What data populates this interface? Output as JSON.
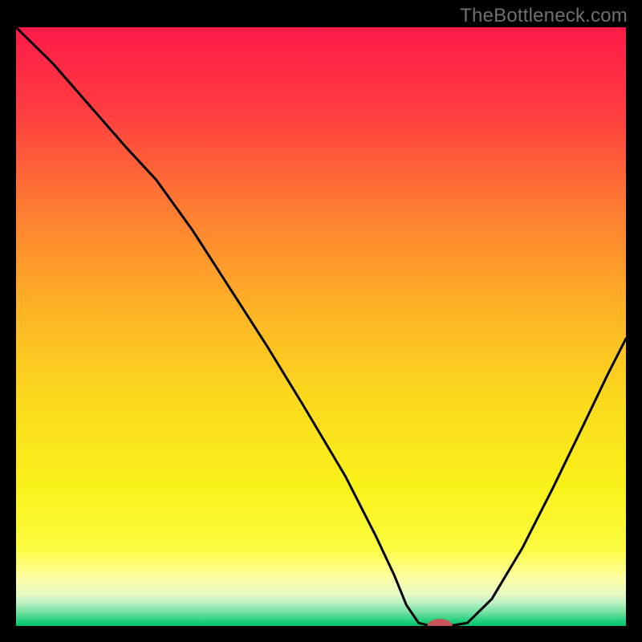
{
  "watermark": "TheBottleneck.com",
  "colors": {
    "black": "#000000",
    "line": "#000000",
    "marker_fill": "#c7565b",
    "marker_stroke": "#c7565b",
    "gradient": [
      {
        "stop": 0.0,
        "hex": "#fe1a48"
      },
      {
        "stop": 0.14,
        "hex": "#ff3d40"
      },
      {
        "stop": 0.3,
        "hex": "#fe7b32"
      },
      {
        "stop": 0.47,
        "hex": "#fdb326"
      },
      {
        "stop": 0.62,
        "hex": "#fbd91d"
      },
      {
        "stop": 0.77,
        "hex": "#f9f21a"
      },
      {
        "stop": 0.87,
        "hex": "#fbfc40"
      },
      {
        "stop": 0.92,
        "hex": "#fdfea4"
      },
      {
        "stop": 0.947,
        "hex": "#e6f9c5"
      },
      {
        "stop": 0.963,
        "hex": "#b5efc2"
      },
      {
        "stop": 0.978,
        "hex": "#6ee09e"
      },
      {
        "stop": 0.989,
        "hex": "#30d183"
      },
      {
        "stop": 1.0,
        "hex": "#00c46b"
      }
    ]
  },
  "chart_data": {
    "type": "line",
    "title": "",
    "xlabel": "",
    "ylabel": "",
    "xlim": [
      0.0,
      1.0
    ],
    "ylim": [
      0.0,
      1.0
    ],
    "grid": false,
    "legend_position": "none",
    "series": [
      {
        "name": "curve",
        "x": [
          0.0,
          0.06,
          0.12,
          0.18,
          0.23,
          0.29,
          0.35,
          0.41,
          0.47,
          0.54,
          0.59,
          0.62,
          0.64,
          0.66,
          0.68,
          0.71,
          0.74,
          0.78,
          0.83,
          0.88,
          0.93,
          0.97,
          1.0
        ],
        "y": [
          1.0,
          0.94,
          0.87,
          0.8,
          0.745,
          0.66,
          0.565,
          0.47,
          0.37,
          0.25,
          0.15,
          0.085,
          0.035,
          0.005,
          0.0,
          0.0,
          0.005,
          0.045,
          0.13,
          0.23,
          0.335,
          0.42,
          0.48
        ]
      }
    ],
    "marker": {
      "x": 0.695,
      "y": 0.0,
      "rx": 0.02,
      "ry": 0.011
    },
    "annotations": []
  }
}
